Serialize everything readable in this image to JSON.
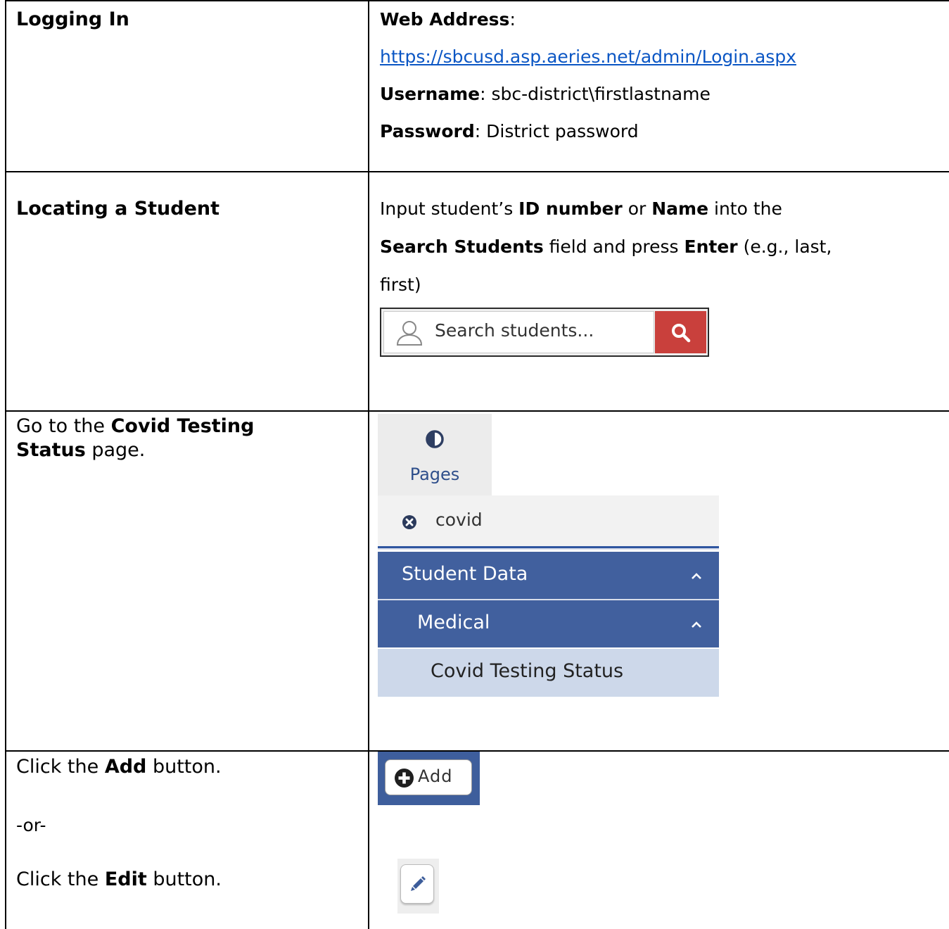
{
  "rows": {
    "login": {
      "heading": "Logging In",
      "web_address_label": "Web Address",
      "web_address_colon": ":",
      "url": "https://sbcusd.asp.aeries.net/admin/Login.aspx",
      "username_label": "Username",
      "username_value": ": sbc-district\\firstlastname",
      "password_label": "Password",
      "password_value": ": District password"
    },
    "locate": {
      "heading": "Locating a Student",
      "line1_a": "Input student’s ",
      "line1_b": "ID number",
      "line1_c": " or ",
      "line1_d": "Name",
      "line1_e": " into the",
      "line2_a": "Search Students",
      "line2_b": " field and press ",
      "line2_c": "Enter",
      "line2_d": " (e.g., last,",
      "line3": "first)",
      "search_placeholder": "Search students...",
      "icons": {
        "user": "user-icon",
        "search": "search-icon"
      },
      "colors": {
        "search_button": "#c9403c"
      }
    },
    "covid": {
      "line1_a": "Go to the ",
      "line1_b": "Covid Testing",
      "line2_a": "Status",
      "line2_b": " page.",
      "pages_label": "Pages",
      "filter_value": "covid",
      "nav_items": [
        "Student Data",
        "Medical"
      ],
      "leaf_item": "Covid Testing Status",
      "icons": {
        "pages": "half-circle-icon",
        "clear": "clear-circle-x-icon",
        "chevron": "chevron-up-icon"
      },
      "colors": {
        "nav": "#41609e",
        "leaf": "#cdd8ea"
      }
    },
    "add_edit": {
      "line1_a": "Click the ",
      "line1_b": "Add",
      "line1_c": " button.",
      "or": "-or-",
      "line2_a": "Click the ",
      "line2_b": "Edit",
      "line2_c": " button.",
      "add_button_label": "Add",
      "icons": {
        "add": "plus-circle-icon",
        "edit": "pencil-icon"
      }
    }
  }
}
